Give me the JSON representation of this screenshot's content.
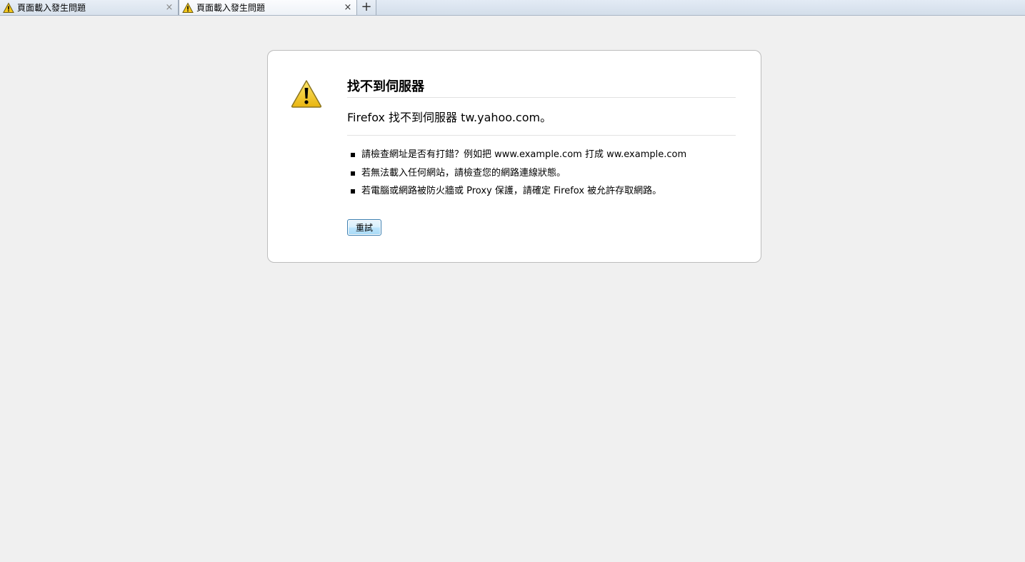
{
  "tabs": [
    {
      "label": "頁面載入發生問題",
      "icon": "warning-icon",
      "active": false
    },
    {
      "label": "頁面載入發生問題",
      "icon": "warning-icon",
      "active": true
    }
  ],
  "tab_close_glyph": "×",
  "new_tab_glyph": "+",
  "error": {
    "title": "找不到伺服器",
    "description": "Firefox 找不到伺服器 tw.yahoo.com。",
    "tips": [
      "請檢查網址是否有打錯？例如把 www.example.com 打成 ww.example.com",
      "若無法載入任何網站，請檢查您的網路連線狀態。",
      "若電腦或網路被防火牆或 Proxy 保護，請確定 Firefox 被允許存取網路。"
    ],
    "retry_label": "重試"
  },
  "colors": {
    "page_background": "#f0f0f0",
    "box_border": "#bdbdbd",
    "warning_yellow": "#f4c81f",
    "button_border": "#3c7fb1"
  }
}
